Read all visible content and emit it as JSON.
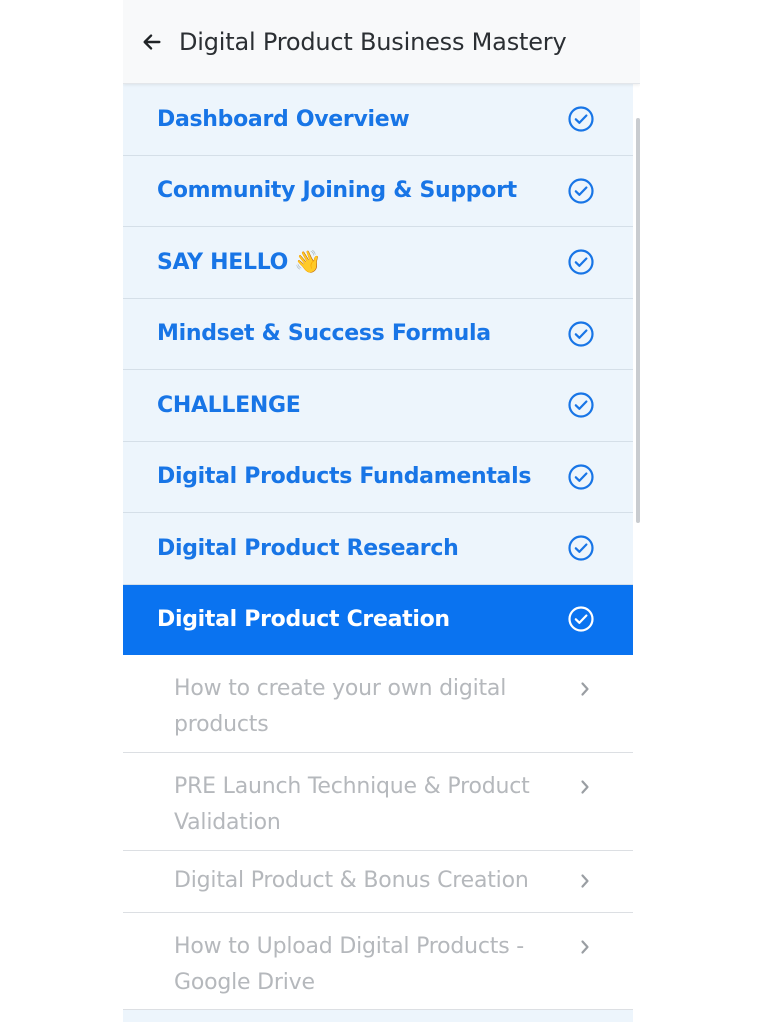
{
  "header": {
    "title": "Digital Product Business Mastery",
    "back_icon": "arrow-left-icon"
  },
  "colors": {
    "accent": "#1875e6",
    "active_bg": "#0a73f0",
    "module_bg": "#edf5fc",
    "lesson_text": "#b5b8bc"
  },
  "modules": [
    {
      "label": "Dashboard Overview",
      "completed": true
    },
    {
      "label": "Community Joining & Support",
      "completed": true
    },
    {
      "label": "SAY HELLO",
      "emoji": "👋",
      "completed": true
    },
    {
      "label": "Mindset & Success Formula",
      "completed": true
    },
    {
      "label": "CHALLENGE",
      "completed": true
    },
    {
      "label": "Digital Products Fundamentals",
      "completed": true
    },
    {
      "label": "Digital Product Research",
      "completed": true
    },
    {
      "label": "Digital Product Creation",
      "completed": true,
      "active": true
    }
  ],
  "lessons": [
    {
      "label": "How to create your own digital products"
    },
    {
      "label": "PRE Launch Technique & Product Validation"
    },
    {
      "label": "Digital Product & Bonus Creation"
    },
    {
      "label": "How to Upload Digital Products - Google Drive"
    }
  ]
}
